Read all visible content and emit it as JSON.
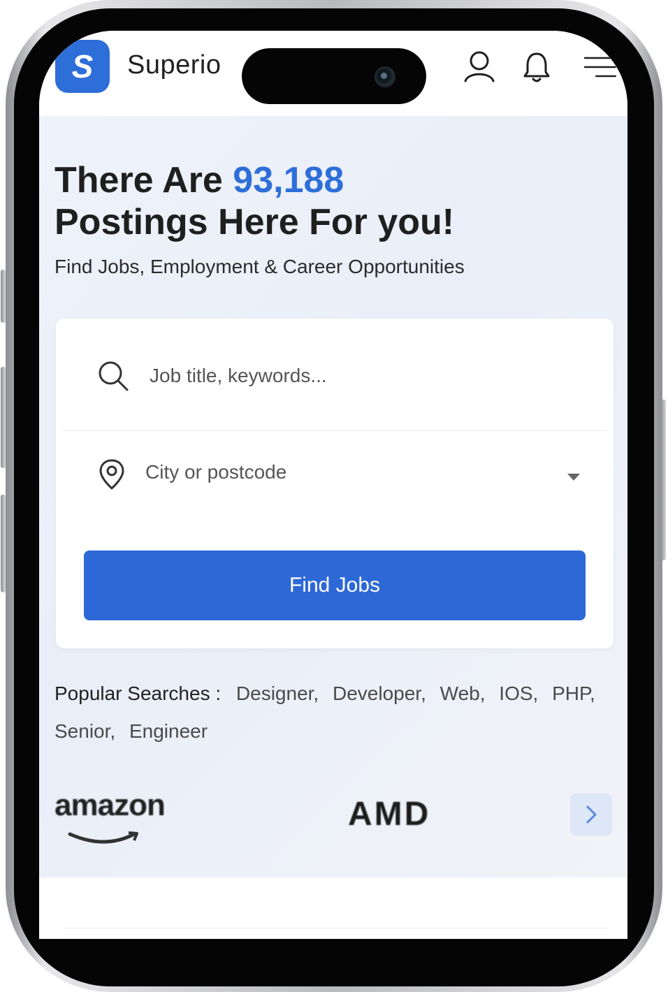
{
  "header": {
    "logo_letter": "S",
    "brand_name": "Superio",
    "icons": [
      "user-icon",
      "bell-icon",
      "menu-icon"
    ]
  },
  "hero": {
    "headline_prefix": "There Are ",
    "headline_count": "93,188",
    "headline_suffix": "Postings Here For you!",
    "subtitle": "Find Jobs, Employment & Career Opportunities"
  },
  "search": {
    "keyword_placeholder": "Job title, keywords...",
    "location_value": "City or postcode",
    "submit_label": "Find Jobs"
  },
  "popular": {
    "label": "Popular Searches :",
    "terms": [
      "Designer,",
      "Developer,",
      "Web,",
      "IOS,",
      "PHP,",
      "Senior,",
      "Engineer"
    ]
  },
  "logos": {
    "amazon": "amazon",
    "amd": "AMD"
  },
  "colors": {
    "accent": "#2d6ed8",
    "button": "#2d68d7",
    "hero_bg": "#eef2fa"
  }
}
